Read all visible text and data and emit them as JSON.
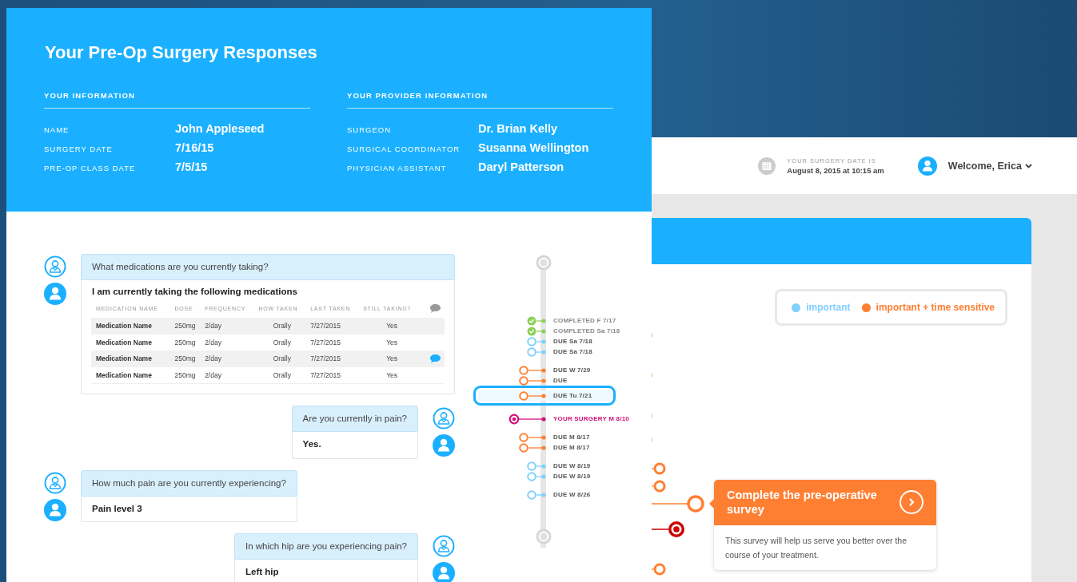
{
  "front_card": {
    "title": "Your Pre-Op Surgery Responses",
    "your_information": {
      "heading": "YOUR INFORMATION",
      "rows": [
        {
          "label": "NAME",
          "value": "John Appleseed"
        },
        {
          "label": "SURGERY DATE",
          "value": "7/16/15"
        },
        {
          "label": "PRE-OP CLASS DATE",
          "value": "7/5/15"
        }
      ]
    },
    "provider_information": {
      "heading": "YOUR PROVIDER INFORMATION",
      "rows": [
        {
          "label": "SURGEON",
          "value": "Dr. Brian Kelly"
        },
        {
          "label": "SURGICAL COORDINATOR",
          "value": "Susanna Wellington"
        },
        {
          "label": "PHYSICIAN ASSISTANT",
          "value": "Daryl Patterson"
        }
      ]
    }
  },
  "conversation": [
    {
      "kind": "left",
      "question": "What medications are you currently taking?",
      "answer": {
        "kind": "table",
        "heading": "I am currently taking the following medications",
        "columns": [
          "MEDICATION NAME",
          "DOSE",
          "FREQUENCY",
          "HOW TAKEN",
          "LAST TAKEN",
          "STILL TAKING?"
        ],
        "rows": [
          {
            "cells": [
              "Medication Name",
              "250mg",
              "2/day",
              "Orally",
              "7/27/2015",
              "Yes"
            ],
            "comment": false
          },
          {
            "cells": [
              "Medication Name",
              "250mg",
              "2/day",
              "Orally",
              "7/27/2015",
              "Yes"
            ],
            "comment": false
          },
          {
            "cells": [
              "Medication Name",
              "250mg",
              "2/day",
              "Orally",
              "7/27/2015",
              "Yes"
            ],
            "comment": true
          },
          {
            "cells": [
              "Medication Name",
              "250mg",
              "2/day",
              "Orally",
              "7/27/2015",
              "Yes"
            ],
            "comment": false
          }
        ]
      }
    },
    {
      "kind": "right",
      "question": "Are you currently in pain?",
      "answer": {
        "kind": "text",
        "text": "Yes."
      }
    },
    {
      "kind": "left",
      "question": "How much pain are you currently experiencing?",
      "answer": {
        "kind": "text",
        "text": "Pain level 3"
      }
    },
    {
      "kind": "right",
      "question": "In which hip are you experiencing pain?",
      "answer": {
        "kind": "text",
        "text": "Left hip"
      }
    }
  ],
  "timeline": {
    "groups": [
      {
        "items": [
          {
            "kind": "completed",
            "label": "COMPLETED F 7/17",
            "color": "#8ed05a",
            "selected": false
          },
          {
            "kind": "completed",
            "label": "COMPLETED Sa 7/18",
            "color": "#8ed05a",
            "selected": false
          },
          {
            "kind": "important",
            "label": "DUE Sa 7/18",
            "color": "#7fd0ff",
            "selected": false
          },
          {
            "kind": "important",
            "label": "DUE Sa 7/18",
            "color": "#7fd0ff",
            "selected": false
          }
        ]
      },
      {
        "items": [
          {
            "kind": "time_sensitive",
            "label": "DUE W 7/29",
            "color": "#ff7f32",
            "selected": false
          },
          {
            "kind": "time_sensitive",
            "label": "DUE",
            "color": "#ff7f32",
            "selected": false
          },
          {
            "kind": "time_sensitive",
            "label": "DUE Tu 7/21",
            "color": "#ff7f32",
            "selected": true
          }
        ]
      },
      {
        "items": [
          {
            "kind": "surgery",
            "label": "YOUR SURGERY M 8/10",
            "color": "#d1127a",
            "selected": false
          }
        ]
      },
      {
        "items": [
          {
            "kind": "time_sensitive",
            "label": "DUE M 8/17",
            "color": "#ff7f32",
            "selected": false
          },
          {
            "kind": "time_sensitive",
            "label": "DUE M 8/17",
            "color": "#ff7f32",
            "selected": false
          }
        ]
      },
      {
        "items": [
          {
            "kind": "important",
            "label": "DUE W 8/19",
            "color": "#7fd0ff",
            "selected": false
          },
          {
            "kind": "important",
            "label": "DUE W 8/19",
            "color": "#7fd0ff",
            "selected": false
          }
        ]
      },
      {
        "items": [
          {
            "kind": "important",
            "label": "DUE W 8/26",
            "color": "#7fd0ff",
            "selected": false
          }
        ]
      }
    ]
  },
  "app": {
    "surgery_date": {
      "label": "YOUR SURGERY DATE IS",
      "value": "August 8, 2015 at 10:15 am"
    },
    "user": {
      "greeting": "Welcome, Erica"
    },
    "legend": [
      {
        "label": "important",
        "color": "#7fd0ff"
      },
      {
        "label": "important + time sensitive",
        "color": "#ff7f32"
      }
    ],
    "survey_card": {
      "title": "Complete the pre-operative survey",
      "body": "This survey will help us serve you better over the course of your treatment."
    }
  }
}
